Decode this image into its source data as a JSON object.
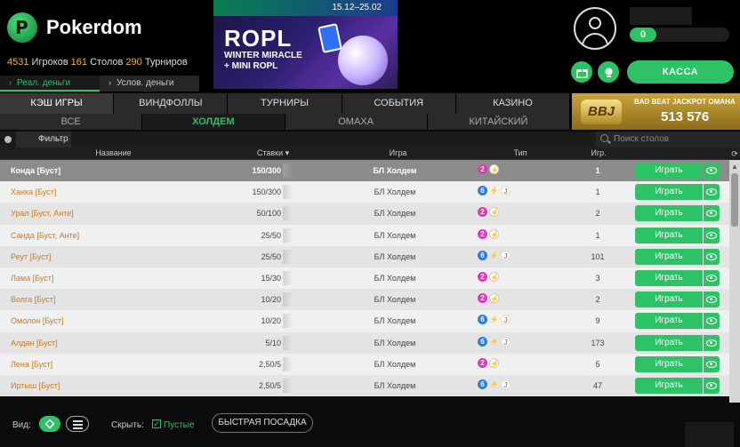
{
  "brand": {
    "name": "Pokerdom"
  },
  "stats": {
    "players_count": "4531",
    "players_label": "Игроков",
    "tables_count": "161",
    "tables_label": "Столов",
    "tournaments_count": "290",
    "tournaments_label": "Турниров"
  },
  "banner": {
    "dates": "15.12–25.02",
    "title": "ROPL",
    "line1": "WINTER MIRACLE",
    "line2": "+ MINI ROPL"
  },
  "account": {
    "balance": "0"
  },
  "header": {
    "kassa_label": "КАССА"
  },
  "money_tabs": [
    {
      "label": "Реал. деньги"
    },
    {
      "label": "Услов. деньги"
    }
  ],
  "category_tabs": [
    {
      "label": "КЭШ ИГРЫ"
    },
    {
      "label": "ВИНДФОЛЛЫ"
    },
    {
      "label": "ТУРНИРЫ"
    },
    {
      "label": "СОБЫТИЯ"
    },
    {
      "label": "КАЗИНО"
    }
  ],
  "sub_tabs": [
    {
      "label": "ВСЕ"
    },
    {
      "label": "ХОЛДЕМ"
    },
    {
      "label": "ОМАХА"
    },
    {
      "label": "КИТАЙСКИЙ"
    }
  ],
  "jackpot": {
    "logo": "BBJ",
    "label": "BAD BEAT JACKPOT OMAHA",
    "amount": "513 576"
  },
  "filter": {
    "label": "Фильтр",
    "search_placeholder": "Поиск столов"
  },
  "table": {
    "columns": {
      "name": "Название",
      "stakes": "Ставки",
      "sort_arrow": "▾",
      "game": "Игра",
      "type": "Тип",
      "players": "Игр."
    },
    "play_label": "Играть",
    "rows": [
      {
        "name": "Конда [Буст]",
        "stakes": "150/300",
        "game": "БЛ Холдем",
        "seats": "2",
        "jackpot": false,
        "players": "1"
      },
      {
        "name": "Ханка [Буст]",
        "stakes": "150/300",
        "game": "БЛ Холдем",
        "seats": "6",
        "jackpot": true,
        "players": "1"
      },
      {
        "name": "Урал [Буст, Анте]",
        "stakes": "50/100",
        "game": "БЛ Холдем",
        "seats": "2",
        "jackpot": false,
        "players": "2"
      },
      {
        "name": "Санда [Буст, Анте]",
        "stakes": "25/50",
        "game": "БЛ Холдем",
        "seats": "2",
        "jackpot": false,
        "players": "1"
      },
      {
        "name": "Реут [Буст]",
        "stakes": "25/50",
        "game": "БЛ Холдем",
        "seats": "6",
        "jackpot": true,
        "players": "101"
      },
      {
        "name": "Лама [Буст]",
        "stakes": "15/30",
        "game": "БЛ Холдем",
        "seats": "2",
        "jackpot": false,
        "players": "3"
      },
      {
        "name": "Волга [Буст]",
        "stakes": "10/20",
        "game": "БЛ Холдем",
        "seats": "2",
        "jackpot": false,
        "players": "2"
      },
      {
        "name": "Омолон [Буст]",
        "stakes": "10/20",
        "game": "БЛ Холдем",
        "seats": "6",
        "jackpot": true,
        "players": "9"
      },
      {
        "name": "Алдан [Буст]",
        "stakes": "5/10",
        "game": "БЛ Холдем",
        "seats": "6",
        "jackpot": true,
        "players": "173"
      },
      {
        "name": "Лена [Буст]",
        "stakes": "2,50/5",
        "game": "БЛ Холдем",
        "seats": "2",
        "jackpot": false,
        "players": "5"
      },
      {
        "name": "Иртыш [Буст]",
        "stakes": "2,50/5",
        "game": "БЛ Холдем",
        "seats": "6",
        "jackpot": true,
        "players": "47"
      }
    ]
  },
  "footer": {
    "view_label": "Вид:",
    "hide_label": "Скрыть:",
    "empty_label": "Пустые",
    "fast_seat_label": "БЫСТРАЯ ПОСАДКА"
  },
  "colors": {
    "accent": "#2ec266",
    "link_orange": "#c87a20",
    "jackpot_gold": "#caa53a"
  },
  "icons": [
    "gift-icon",
    "trophy-icon",
    "search-icon",
    "eye-icon",
    "bolt-icon",
    "jackpot-j-icon"
  ]
}
